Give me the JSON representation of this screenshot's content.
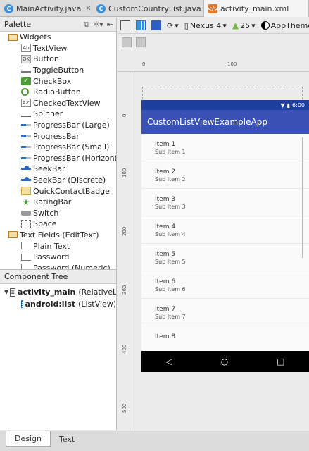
{
  "tabs": [
    {
      "label": "MainActivity.java",
      "icon": "c-java-icon"
    },
    {
      "label": "CustomCountryList.java",
      "icon": "c-java-icon"
    },
    {
      "label": "activity_main.xml",
      "icon": "xml-file-icon"
    }
  ],
  "palette": {
    "title": "Palette",
    "categories": [
      {
        "label": "Widgets",
        "items": [
          {
            "label": "TextView",
            "glyph": "Ab"
          },
          {
            "label": "Button",
            "glyph": "OK"
          },
          {
            "label": "ToggleButton",
            "glyph": ""
          },
          {
            "label": "CheckBox",
            "glyph": "✓"
          },
          {
            "label": "RadioButton",
            "glyph": ""
          },
          {
            "label": "CheckedTextView",
            "glyph": "A✓"
          },
          {
            "label": "Spinner",
            "glyph": ""
          },
          {
            "label": "ProgressBar (Large)",
            "glyph": ""
          },
          {
            "label": "ProgressBar",
            "glyph": ""
          },
          {
            "label": "ProgressBar (Small)",
            "glyph": ""
          },
          {
            "label": "ProgressBar (Horizontal)",
            "glyph": ""
          },
          {
            "label": "SeekBar",
            "glyph": ""
          },
          {
            "label": "SeekBar (Discrete)",
            "glyph": ""
          },
          {
            "label": "QuickContactBadge",
            "glyph": ""
          },
          {
            "label": "RatingBar",
            "glyph": "★"
          },
          {
            "label": "Switch",
            "glyph": ""
          },
          {
            "label": "Space",
            "glyph": ""
          }
        ]
      },
      {
        "label": "Text Fields (EditText)",
        "items": [
          {
            "label": "Plain Text",
            "glyph": ""
          },
          {
            "label": "Password",
            "glyph": ""
          },
          {
            "label": "Password (Numeric)",
            "glyph": ""
          }
        ]
      }
    ]
  },
  "component_tree": {
    "title": "Component Tree",
    "root": {
      "id": "activity_main",
      "type": "(RelativeLayout)"
    },
    "child": {
      "id": "android:list",
      "type": "(ListView)"
    }
  },
  "toolbar": {
    "device": "Nexus 4",
    "api": "25",
    "theme": "AppTheme"
  },
  "ruler": {
    "h_ticks": [
      "0",
      "100"
    ],
    "v_ticks": [
      "0",
      "100",
      "200",
      "300",
      "400",
      "500"
    ]
  },
  "preview": {
    "status_time": "6:00",
    "app_title": "CustomListViewExampleApp",
    "list_items": [
      {
        "title": "Item 1",
        "sub": "Sub Item 1"
      },
      {
        "title": "Item 2",
        "sub": "Sub Item 2"
      },
      {
        "title": "Item 3",
        "sub": "Sub Item 3"
      },
      {
        "title": "Item 4",
        "sub": "Sub Item 4"
      },
      {
        "title": "Item 5",
        "sub": "Sub Item 5"
      },
      {
        "title": "Item 6",
        "sub": "Sub Item 6"
      },
      {
        "title": "Item 7",
        "sub": "Sub Item 7"
      },
      {
        "title": "Item 8",
        "sub": ""
      }
    ]
  },
  "bottom_tabs": [
    {
      "label": "Design"
    },
    {
      "label": "Text"
    }
  ],
  "colors": {
    "statusbar": "#1f3f9f",
    "appbar": "#3a51b5",
    "navbar": "#000000"
  }
}
